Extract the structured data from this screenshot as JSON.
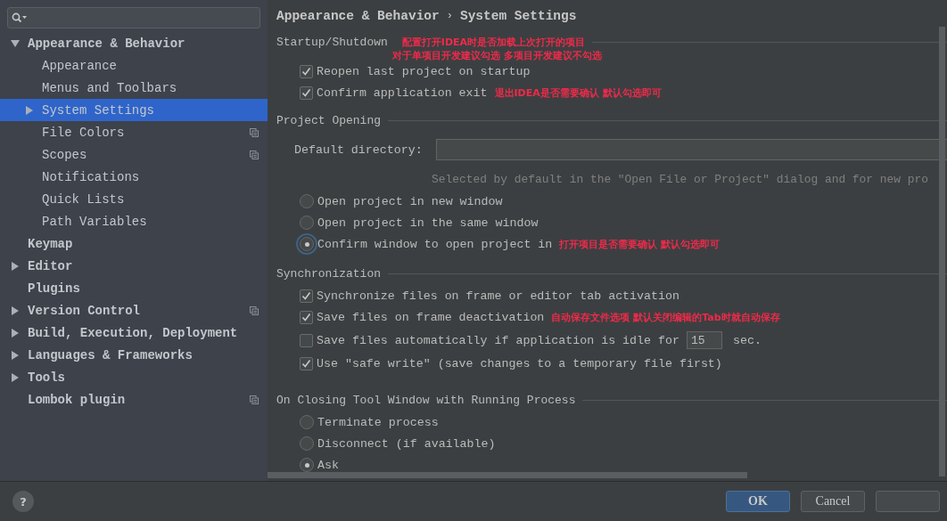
{
  "sidebar": {
    "items": [
      {
        "label": "Appearance & Behavior",
        "kind": "expandable",
        "expanded": true,
        "selected": false,
        "per_project": false,
        "children": [
          {
            "label": "Appearance",
            "kind": "plain",
            "selected": false,
            "per_project": false
          },
          {
            "label": "Menus and Toolbars",
            "kind": "plain",
            "selected": false,
            "per_project": false
          },
          {
            "label": "System Settings",
            "kind": "expandable",
            "expanded": false,
            "selected": true,
            "per_project": false
          },
          {
            "label": "File Colors",
            "kind": "plain",
            "selected": false,
            "per_project": true
          },
          {
            "label": "Scopes",
            "kind": "plain",
            "selected": false,
            "per_project": true
          },
          {
            "label": "Notifications",
            "kind": "plain",
            "selected": false,
            "per_project": false
          },
          {
            "label": "Quick Lists",
            "kind": "plain",
            "selected": false,
            "per_project": false
          },
          {
            "label": "Path Variables",
            "kind": "plain",
            "selected": false,
            "per_project": false
          }
        ]
      },
      {
        "label": "Keymap",
        "kind": "plain",
        "selected": false,
        "per_project": false
      },
      {
        "label": "Editor",
        "kind": "expandable",
        "expanded": false,
        "selected": false,
        "per_project": false
      },
      {
        "label": "Plugins",
        "kind": "plain",
        "selected": false,
        "per_project": false
      },
      {
        "label": "Version Control",
        "kind": "expandable",
        "expanded": false,
        "selected": false,
        "per_project": true
      },
      {
        "label": "Build, Execution, Deployment",
        "kind": "expandable",
        "expanded": false,
        "selected": false,
        "per_project": false
      },
      {
        "label": "Languages & Frameworks",
        "kind": "expandable",
        "expanded": false,
        "selected": false,
        "per_project": false
      },
      {
        "label": "Tools",
        "kind": "expandable",
        "expanded": false,
        "selected": false,
        "per_project": false
      },
      {
        "label": "Lombok plugin",
        "kind": "plain",
        "selected": false,
        "per_project": true
      }
    ]
  },
  "breadcrumb": {
    "parts": [
      "Appearance & Behavior",
      "System Settings"
    ],
    "separator": "›"
  },
  "sections": [
    {
      "title": "Startup/Shutdown",
      "annotation": [
        "配置打开IDEA时是否加载上次打开的项目",
        "对于单项目开发建议勾选 多项目开发建议不勾选"
      ],
      "rows": [
        {
          "kind": "checkbox",
          "label": "Reopen last project on startup",
          "checked": true
        },
        {
          "kind": "checkbox",
          "label": "Confirm application exit",
          "checked": true,
          "annotation": "退出IDEA是否需要确认 默认勾选即可"
        }
      ]
    },
    {
      "title": "Project Opening",
      "rows": [
        {
          "kind": "field",
          "label": "Default directory:"
        },
        {
          "kind": "hint",
          "label": "Selected by default in the \"Open File or Project\" dialog and for new pro"
        },
        {
          "kind": "radio",
          "label": "Open project in new window",
          "selected": false
        },
        {
          "kind": "radio",
          "label": "Open project in the same window",
          "selected": false
        },
        {
          "kind": "radio",
          "label": "Confirm window to open project in",
          "selected": true,
          "focused": true,
          "annotation": "打开项目是否需要确认 默认勾选即可"
        }
      ]
    },
    {
      "title": "Synchronization",
      "rows": [
        {
          "kind": "checkbox",
          "label": "Synchronize files on frame or editor tab activation",
          "checked": true
        },
        {
          "kind": "checkbox",
          "label": "Save files on frame deactivation",
          "checked": true,
          "annotation": "自动保存文件选项 默认关闭编辑的Tab时就自动保存"
        },
        {
          "kind": "checkbox_number",
          "label": "Save files automatically if application is idle for",
          "checked": false,
          "value": "15",
          "unit": "sec."
        },
        {
          "kind": "checkbox",
          "label": "Use \"safe write\" (save changes to a temporary file first)",
          "checked": true
        }
      ]
    },
    {
      "title": "On Closing Tool Window with Running Process",
      "rows": [
        {
          "kind": "radio",
          "label": "Terminate process",
          "selected": false
        },
        {
          "kind": "radio",
          "label": "Disconnect (if available)",
          "selected": false
        },
        {
          "kind": "radio",
          "label": "Ask",
          "selected": true
        }
      ]
    }
  ],
  "help": "?",
  "buttons": [
    {
      "label": "OK",
      "default": true
    },
    {
      "label": "Cancel",
      "default": false
    },
    {
      "default": false
    }
  ]
}
